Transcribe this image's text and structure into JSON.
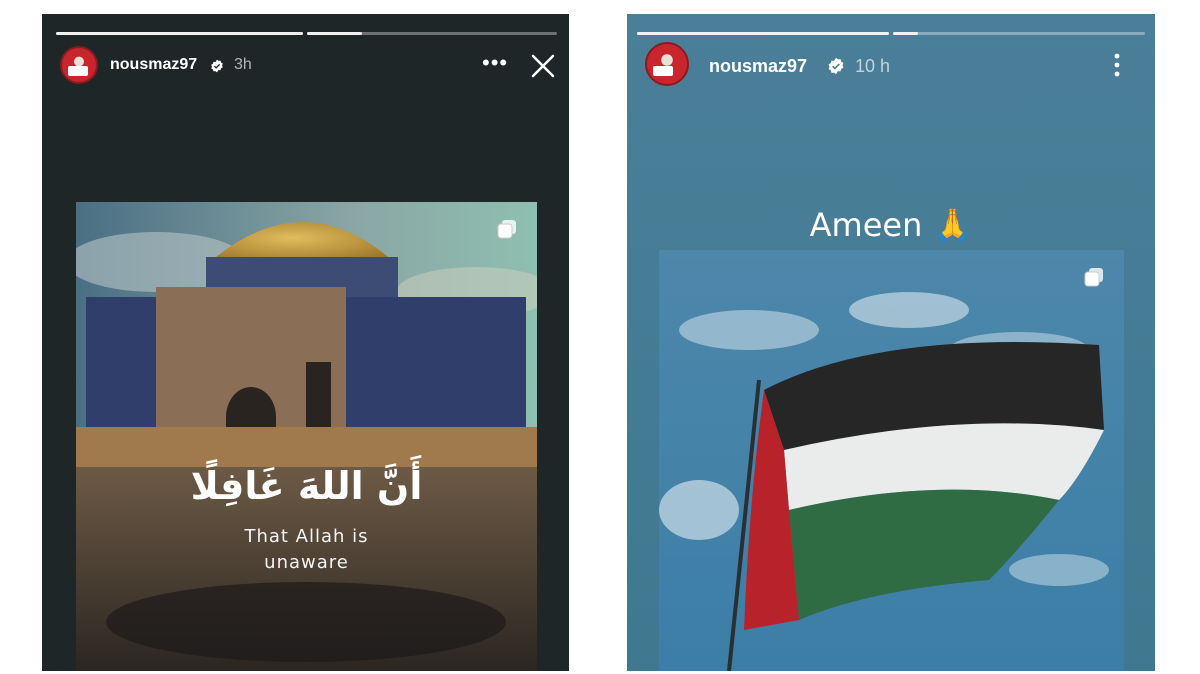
{
  "left_story": {
    "username": "nousmaz97",
    "time": "3h",
    "progress": [
      1.0,
      0.22
    ],
    "post": {
      "arabic_text": "أَنَّ اللهَ غَافِلًا",
      "caption_line1": "That Allah is",
      "caption_line2": "unaware"
    },
    "icons": [
      "verified-icon",
      "more-options-icon",
      "close-icon",
      "multi-photo-icon"
    ]
  },
  "right_story": {
    "username": "nousmaz97",
    "time": "10 h",
    "progress": [
      1.0,
      0.1
    ],
    "text": "Ameen 🙏",
    "icons": [
      "verified-icon",
      "more-options-icon",
      "multi-photo-icon"
    ]
  },
  "colors": {
    "left_bg": "#1f2628",
    "right_bg": "#467d96",
    "avatar_red": "#c8252c"
  }
}
